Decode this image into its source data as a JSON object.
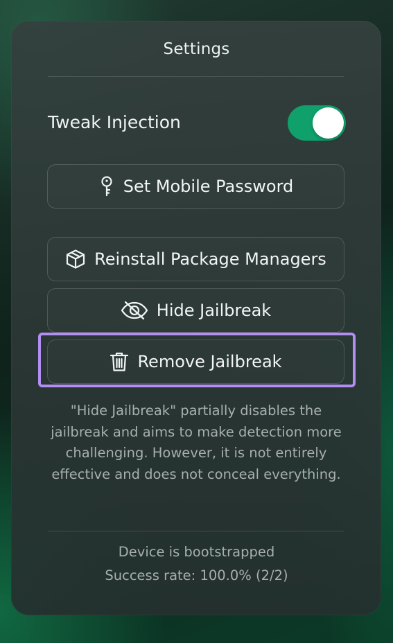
{
  "settings": {
    "title": "Settings",
    "tweak_injection": {
      "label": "Tweak Injection",
      "enabled": true,
      "on_color": "#0fa06b"
    },
    "buttons": [
      {
        "label": "Set Mobile Password",
        "icon": "key-icon"
      },
      {
        "label": "Reinstall Package Managers",
        "icon": "package-icon"
      },
      {
        "label": "Hide Jailbreak",
        "icon": "eye-slash-icon"
      },
      {
        "label": "Remove Jailbreak",
        "icon": "trash-icon"
      }
    ],
    "note": "\"Hide Jailbreak\" partially disables the jailbreak and aims to make detection more challenging. However, it is not entirely effective and does not conceal everything.",
    "status": {
      "line1": "Device is bootstrapped",
      "line2": "Success rate: 100.0% (2/2)"
    },
    "highlight_color": "#b38ef2"
  }
}
